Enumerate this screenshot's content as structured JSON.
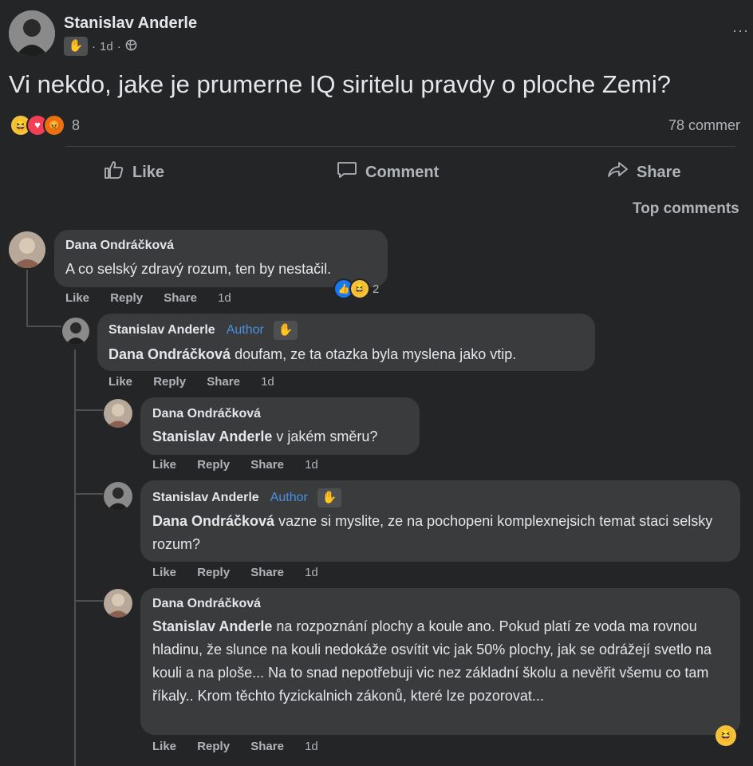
{
  "post": {
    "author": "Stanislav Anderle",
    "time": "1d",
    "dot": "·",
    "text": "Vi nekdo, jake je prumerne IQ siritelu pravdy o ploche Zemi?",
    "reaction_count": "8",
    "comments_count": "78 commer",
    "more": "···"
  },
  "actions": {
    "like": "Like",
    "comment": "Comment",
    "share": "Share"
  },
  "sort_label": "Top comments",
  "comment_actions": {
    "like": "Like",
    "reply": "Reply",
    "share": "Share"
  },
  "comments": [
    {
      "name": "Dana Ondráčková",
      "text": "A co selský zdravý rozum, ten by nestačil.",
      "time": "1d",
      "reactions": "2"
    },
    {
      "name": "Stanislav Anderle",
      "author_label": "Author",
      "mention": "Dana Ondráčková",
      "text": " doufam, ze ta otazka byla myslena jako vtip.",
      "time": "1d"
    },
    {
      "name": "Dana Ondráčková",
      "mention": "Stanislav Anderle",
      "text": " v jakém směru?",
      "time": "1d"
    },
    {
      "name": "Stanislav Anderle",
      "author_label": "Author",
      "mention": "Dana Ondráčková",
      "text": " vazne si myslite, ze na pochopeni komplexnejsich temat staci selsky rozum?",
      "time": "1d"
    },
    {
      "name": "Dana Ondráčková",
      "mention": "Stanislav Anderle",
      "text": " na rozpoznání plochy a koule ano. Pokud platí ze voda ma rovnou hladinu, že slunce na kouli nedokáže osvítit vic jak 50% plochy, jak se odrážejí svetlo na kouli a na ploše... Na to snad nepotřebuji vic nez základní školu a nevěřit všemu co tam říkaly.. Krom těchto fyzickalnich zákonů, které lze pozorovat...",
      "time": "1d"
    }
  ]
}
